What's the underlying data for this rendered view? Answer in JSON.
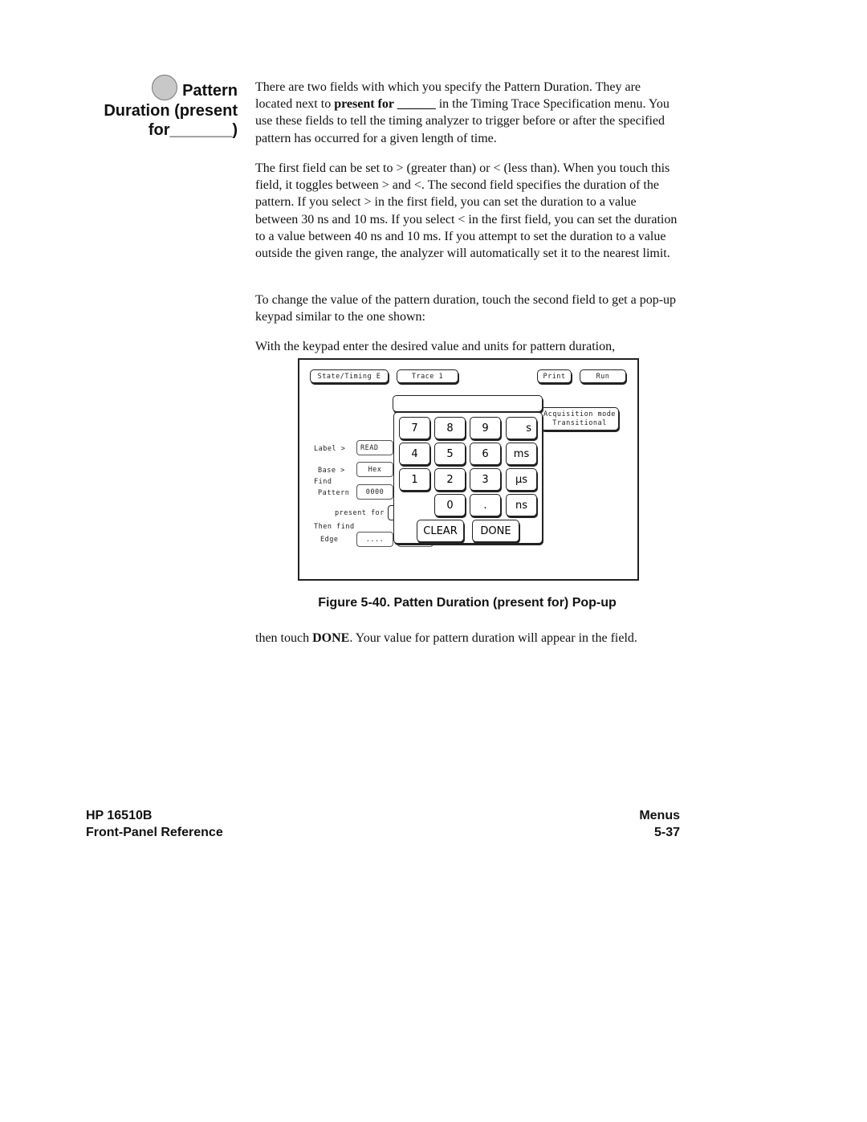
{
  "side_heading": {
    "line1": "Pattern",
    "line2": "Duration (present",
    "line3": "for_______)"
  },
  "paragraphs": [
    "There are two fields with which you specify the Pattern Duration. They are located next to",
    "present for ______",
    "in the Timing Trace Specification menu. You use these fields to tell the timing analyzer to trigger before or after the specified pattern has occurred for a given length of time.",
    "The first field can be set to > (greater than) or < (less than). When you touch this field, it toggles between > and <. The second field specifies the duration of the pattern. If you select > in the first field, you can set the duration to a value between 30 ns and 10 ms. If you select < in the first field, you can set the duration to a value between 40 ns and 10 ms. If you attempt to set the duration to a value outside the given range, the analyzer will automatically set it to the nearest limit.",
    "To change the value of the pattern duration, touch the second field to get a pop-up keypad similar to the one shown:",
    "With the keypad enter the desired value and units for pattern duration,"
  ],
  "figure": {
    "top_buttons": [
      "State/Timing E",
      "Trace 1",
      "Print",
      "Run"
    ],
    "acquisition": {
      "label": "Acquisition mode",
      "value": "Transitional"
    },
    "labels": {
      "label": "Label >",
      "base": "Base >",
      "find": "Find",
      "pattern": "Pattern",
      "present_for": "present for",
      "then_find": "Then find",
      "edge": "Edge"
    },
    "fields": {
      "label": "READ",
      "base": "Hex",
      "pattern": "0000",
      "edge": "...."
    },
    "display_value": "",
    "keys": [
      "7",
      "8",
      "9",
      "s",
      "4",
      "5",
      "6",
      "ms",
      "1",
      "2",
      "3",
      "µs",
      "0",
      ".",
      "ns"
    ],
    "clear": "CLEAR",
    "done": "DONE"
  },
  "caption": "Figure 5-40. Patten Duration (present for) Pop-up",
  "after": {
    "pre": "then touch ",
    "bold": "DONE",
    "post": ". Your value for pattern duration will appear in the field."
  },
  "footer": {
    "product": "HP 16510B",
    "manual": "Front-Panel Reference",
    "section": "Menus",
    "page": "5-37"
  }
}
